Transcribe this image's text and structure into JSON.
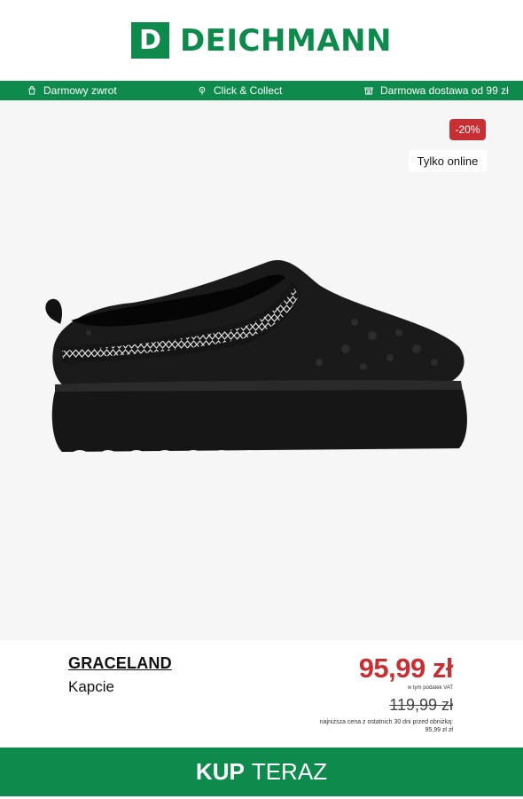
{
  "header": {
    "logo_letter": "D",
    "logo_text": "DEICHMANN",
    "brand_color": "#0e8a4d"
  },
  "info_bar": {
    "items": [
      {
        "icon": "shopping-bag-icon",
        "label": "Darmowy zwrot"
      },
      {
        "icon": "location-pin-icon",
        "label": "Click & Collect"
      },
      {
        "icon": "store-icon",
        "label": "Darmowa dostawa od 99 zł"
      }
    ]
  },
  "product": {
    "discount_badge": "-20%",
    "availability_badge": "Tylko online",
    "image_icon": "slipper-image",
    "brand": "GRACELAND",
    "type": "Kapcie",
    "price": "95,99 zł",
    "vat_note": "w tym podatek VAT",
    "old_price": "119,99 zł",
    "lowest_price_note": "najniższa cena z ostatnich 30 dni przed obniżką:",
    "lowest_price_value": "95,99 zł zł",
    "price_color": "#c62f33"
  },
  "cta": {
    "bold": "KUP",
    "rest": "TERAZ"
  }
}
